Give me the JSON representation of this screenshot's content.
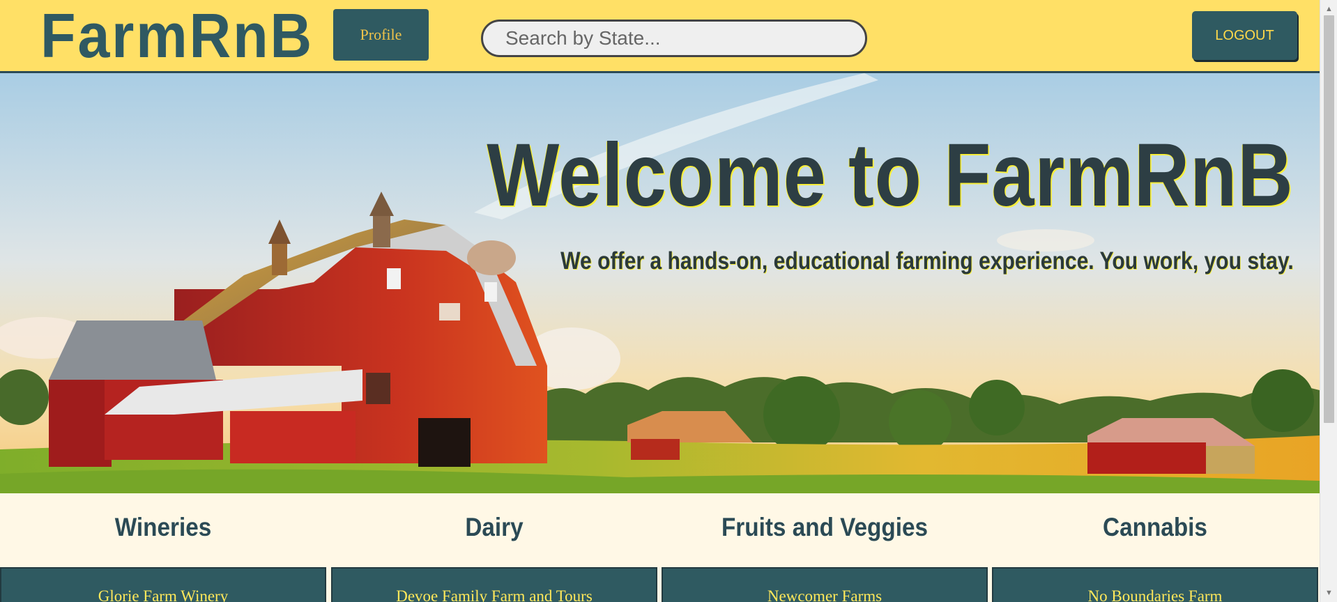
{
  "header": {
    "brand": "FarmRnB",
    "profile_label": "Profile",
    "search_placeholder": "Search by State...",
    "logout_label": "LOGOUT"
  },
  "hero": {
    "title": "Welcome to FarmRnB",
    "subtitle": "We offer a hands-on, educational farming experience. You work, you stay."
  },
  "categories": [
    {
      "title": "Wineries",
      "first_farm": "Glorie Farm Winery"
    },
    {
      "title": "Dairy",
      "first_farm": "Devoe Family Farm and Tours"
    },
    {
      "title": "Fruits and Veggies",
      "first_farm": "Newcomer Farms"
    },
    {
      "title": "Cannabis",
      "first_farm": "No Boundaries Farm"
    }
  ],
  "colors": {
    "header_bg": "#ffe066",
    "accent": "#2f5a61",
    "button_text": "#f0c34a",
    "page_bg": "#fff8e6"
  },
  "icons": {
    "scroll_up": "triangle-up-icon",
    "scroll_down": "triangle-down-icon"
  }
}
